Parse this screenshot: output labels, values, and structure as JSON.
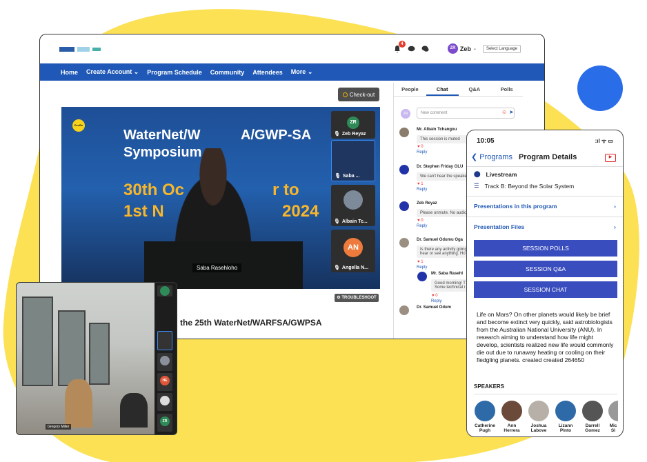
{
  "desktop": {
    "notif_count": "4",
    "user_initials": "ZR",
    "user_name": "Zeb",
    "language": "Select Language",
    "nav": [
      "Home",
      "Create Account",
      "Program Schedule",
      "Community",
      "Attendees",
      "More"
    ],
    "checkout": "Check-out",
    "video": {
      "line1": "WaterNet/W",
      "line1b": "A/GWP-SA",
      "line2": "Symposium",
      "date1": "30th Oc",
      "date1b": "r to",
      "date2": "1st N",
      "year": "2024",
      "speaker_name": "Saba Rasehloho",
      "logo_text": "DevBe"
    },
    "tiles": [
      {
        "initials": "ZR",
        "name": "Zeb Reyaz",
        "color": "#2e8b57"
      },
      {
        "initials": "",
        "name": "Saba ...",
        "color": ""
      },
      {
        "initials": "",
        "name": "Albain Tc...",
        "color": ""
      },
      {
        "initials": "AN",
        "name": "Angella N...",
        "color": "#ee7b3c"
      }
    ],
    "troubleshoot": "TROUBLESHOOT",
    "session_title": "the 25th WaterNet/WARFSA/GWPSA",
    "chat": {
      "tabs": [
        "People",
        "Chat",
        "Q&A",
        "Polls"
      ],
      "comment_placeholder": "New comment",
      "my_initials": "ZR",
      "messages": [
        {
          "who": "Mr. Albain Tchangou",
          "text": "This session is muted",
          "likes": "0",
          "reply": "Reply",
          "w": "We"
        },
        {
          "who": "Dr. Stephen Friday OLU",
          "text": "We can't hear the speake",
          "likes": "1",
          "reply": "Reply",
          "w": "We"
        },
        {
          "who": "Zeb Reyaz",
          "text": "Please unmute. No audic",
          "likes": "0",
          "reply": "Reply",
          "w": "We"
        },
        {
          "who": "Dr. Samuel Odumu Oga",
          "text": "Is there any activity going",
          "text2": "hear or see anything. Ho",
          "likes": "1",
          "reply": "Reply",
          "w": "We"
        },
        {
          "who": "Mr. Saba Rasehl",
          "text": "Good morning! T",
          "text2": "Some technical i",
          "likes": "0",
          "reply": "Reply",
          "w": "We"
        },
        {
          "who": "Dr. Samuel Odum",
          "text": "",
          "likes": "",
          "reply": "",
          "w": ""
        }
      ]
    }
  },
  "mobile": {
    "time": "10:05",
    "status": ":ıl ᯤ ▭",
    "back": "Programs",
    "title": "Program Details",
    "livestream": "Livestream",
    "track": "Track B: Beyond the Solar System",
    "links": [
      "Presentations in this program",
      "Presentation Files"
    ],
    "buttons": [
      "SESSION POLLS",
      "SESSION Q&A",
      "SESSION CHAT"
    ],
    "description": "Life on Mars? On other planets would likely be brief and become extinct very quickly, said astrobiologists from the Australian National University (ANU). In research aiming to understand how life might develop, scientists realized new life would commonly die out due to runaway heating or cooling on their fledgling planets. created created 264650",
    "speakers_label": "SPEAKERS",
    "speakers": [
      {
        "first": "Catherine",
        "last": "Pugh"
      },
      {
        "first": "Ann",
        "last": "Herrera"
      },
      {
        "first": "Joshua",
        "last": "Labove"
      },
      {
        "first": "Lizann",
        "last": "Pinto"
      },
      {
        "first": "Darrell",
        "last": "Gomez"
      },
      {
        "first": "Mic",
        "last": "Sl"
      }
    ]
  },
  "zoom": {
    "presenter": "Gregory Miller",
    "tiles": [
      {
        "initials": "",
        "name": "Zeb Reyaz"
      },
      {
        "initials": "",
        "name": "Gregory..."
      },
      {
        "initials": "",
        "name": "Albain..."
      },
      {
        "initials": "HE",
        "name": "HE:DGB S..."
      },
      {
        "initials": "",
        "name": "Katrina W..."
      },
      {
        "initials": "ZR",
        "name": "Zeb Reyaz"
      }
    ]
  },
  "colors": {
    "brand_blue": "#1f58b6",
    "yellow": "#fce154",
    "accent_blue": "#2a6de8",
    "button": "#3a4dbe"
  }
}
